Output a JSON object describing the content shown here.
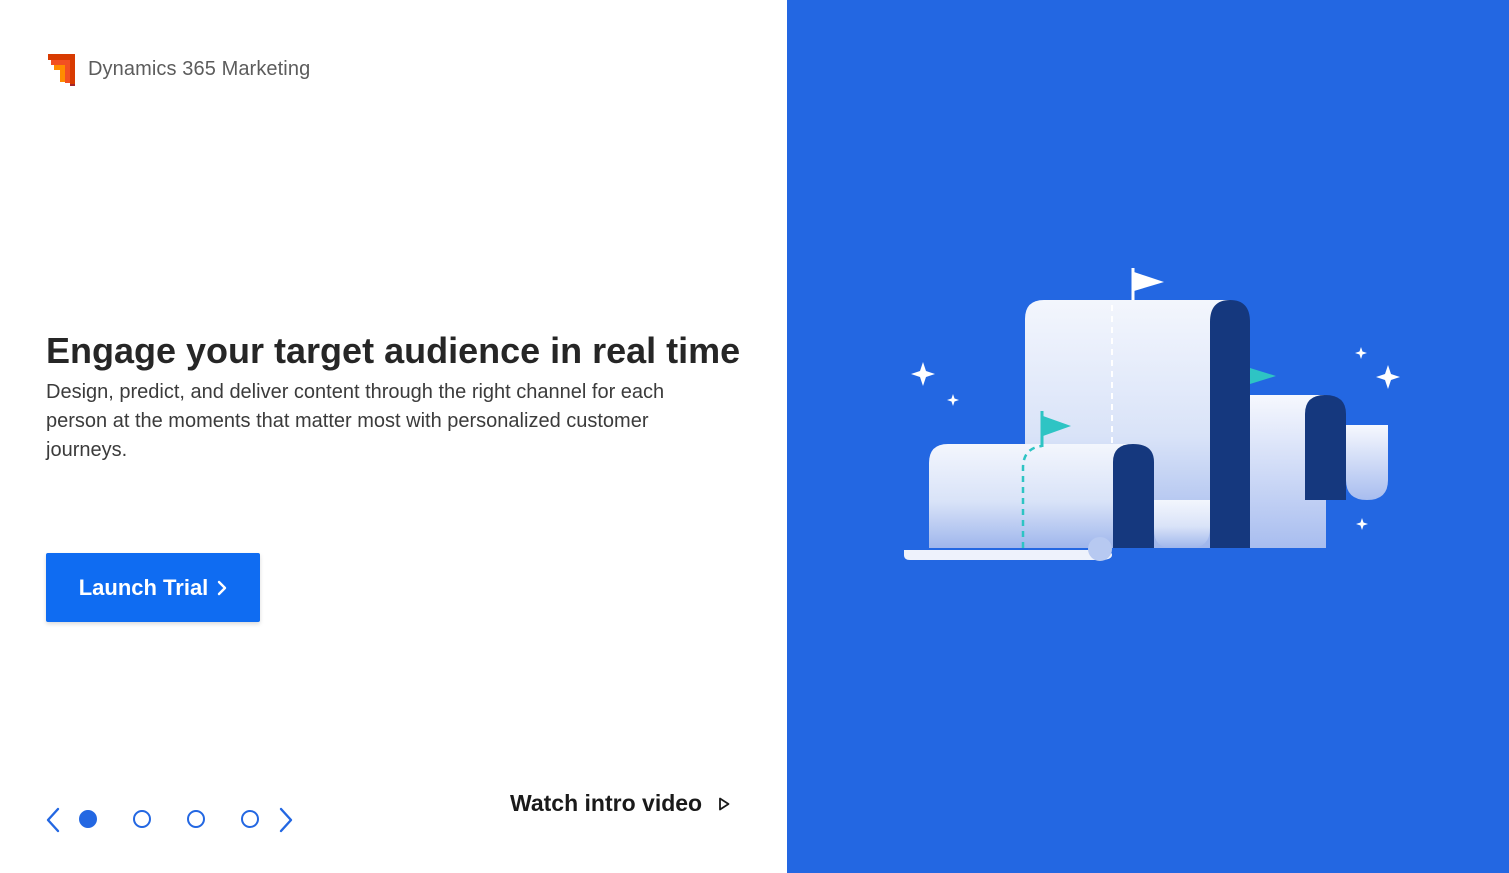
{
  "brand": {
    "name": "Dynamics 365 Marketing",
    "logo_icon": "dynamics-marketing-logo-icon",
    "logo_colors": [
      "#f25022",
      "#d83b01",
      "#ff8c00"
    ]
  },
  "hero": {
    "title": "Engage your target audience in real time",
    "description": "Design, predict, and deliver content through the right channel for each person at the moments that matter most with personalized customer journeys."
  },
  "cta": {
    "launch_label": "Launch Trial",
    "launch_icon": "chevron-right-icon"
  },
  "carousel": {
    "prev_icon": "chevron-left-icon",
    "next_icon": "chevron-right-icon",
    "slide_count": 4,
    "active_slide": 1
  },
  "video": {
    "label": "Watch intro video",
    "icon": "play-icon"
  },
  "illustration": {
    "subject": "scroll-chart-with-flags-illustration",
    "background_color": "#2367e2",
    "accent_color": "#2ec4c4",
    "dark_color": "#15387e"
  },
  "colors": {
    "primary_button": "#0f6cf2",
    "carousel_accent": "#2367e2",
    "title_text": "#262626"
  }
}
